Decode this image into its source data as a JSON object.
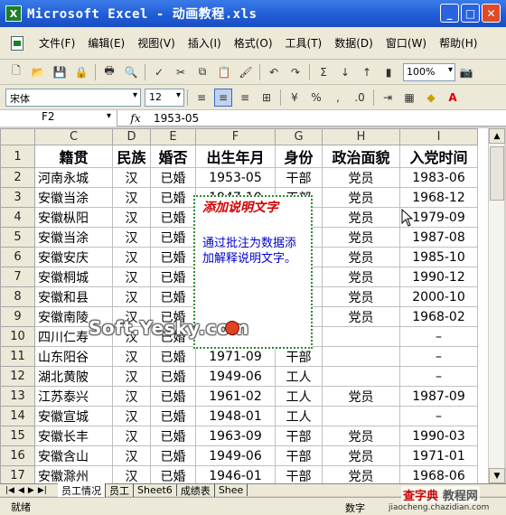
{
  "window": {
    "title": "Microsoft Excel - 动画教程.xls",
    "app_icon": "excel-icon"
  },
  "menu": [
    "文件(F)",
    "编辑(E)",
    "视图(V)",
    "插入(I)",
    "格式(O)",
    "工具(T)",
    "数据(D)",
    "窗口(W)",
    "帮助(H)"
  ],
  "toolbar": {
    "zoom": "100%",
    "font_name": "宋体",
    "font_size": "12"
  },
  "formula_bar": {
    "cell_ref": "F2",
    "fx": "fx",
    "content": "1953-05"
  },
  "columns": [
    "C",
    "D",
    "E",
    "F",
    "G",
    "H",
    "I"
  ],
  "header_row": [
    "籍贯",
    "民族",
    "婚否",
    "出生年月",
    "身份",
    "政治面貌",
    "入党时间"
  ],
  "rows": [
    {
      "n": "2",
      "cells": [
        "河南永城",
        "汉",
        "已婚",
        "1953-05",
        "干部",
        "党员",
        "1983-06"
      ]
    },
    {
      "n": "3",
      "cells": [
        "安徽当涂",
        "汉",
        "已婚",
        "1947-10",
        "干部",
        "党员",
        "1968-12"
      ]
    },
    {
      "n": "4",
      "cells": [
        "安徽枞阳",
        "汉",
        "已婚",
        "",
        "",
        "党员",
        "1979-09"
      ]
    },
    {
      "n": "5",
      "cells": [
        "安徽当涂",
        "汉",
        "已婚",
        "",
        "",
        "党员",
        "1987-08"
      ]
    },
    {
      "n": "6",
      "cells": [
        "安徽安庆",
        "汉",
        "已婚",
        "",
        "",
        "党员",
        "1985-10"
      ]
    },
    {
      "n": "7",
      "cells": [
        "安徽桐城",
        "汉",
        "已婚",
        "",
        "",
        "党员",
        "1990-12"
      ]
    },
    {
      "n": "8",
      "cells": [
        "安徽和县",
        "汉",
        "已婚",
        "",
        "",
        "党员",
        "2000-10"
      ]
    },
    {
      "n": "9",
      "cells": [
        "安徽南陵",
        "汉",
        "已婚",
        "",
        "",
        "党员",
        "1968-02"
      ]
    },
    {
      "n": "10",
      "cells": [
        "四川仁寿",
        "汉",
        "已婚",
        "",
        "",
        "",
        "–"
      ]
    },
    {
      "n": "11",
      "cells": [
        "山东阳谷",
        "汉",
        "已婚",
        "1971-09",
        "干部",
        "",
        "–"
      ]
    },
    {
      "n": "12",
      "cells": [
        "湖北黄陂",
        "汉",
        "已婚",
        "1949-06",
        "工人",
        "",
        "–"
      ]
    },
    {
      "n": "13",
      "cells": [
        "江苏泰兴",
        "汉",
        "已婚",
        "1961-02",
        "工人",
        "党员",
        "1987-09"
      ]
    },
    {
      "n": "14",
      "cells": [
        "安徽宣城",
        "汉",
        "已婚",
        "1948-01",
        "工人",
        "",
        "–"
      ]
    },
    {
      "n": "15",
      "cells": [
        "安徽长丰",
        "汉",
        "已婚",
        "1963-09",
        "干部",
        "党员",
        "1990-03"
      ]
    },
    {
      "n": "16",
      "cells": [
        "安徽含山",
        "汉",
        "已婚",
        "1949-06",
        "干部",
        "党员",
        "1971-01"
      ]
    },
    {
      "n": "17",
      "cells": [
        "安徽滁州",
        "汉",
        "已婚",
        "1946-01",
        "干部",
        "党员",
        "1968-06"
      ]
    }
  ],
  "comment": {
    "title": "添加说明文字",
    "body": "通过批注为数据添加解释说明文字。"
  },
  "watermark": "Soft.Yesky.com",
  "sheet_tabs": [
    "员工情况",
    "员工",
    "Sheet6",
    "成绩表",
    "Shee"
  ],
  "status": {
    "left": "就绪",
    "num": "数字"
  },
  "corner_watermark": {
    "brand": "查字典",
    "suffix": "教程网",
    "url": "jiaocheng.chazidian.com"
  }
}
